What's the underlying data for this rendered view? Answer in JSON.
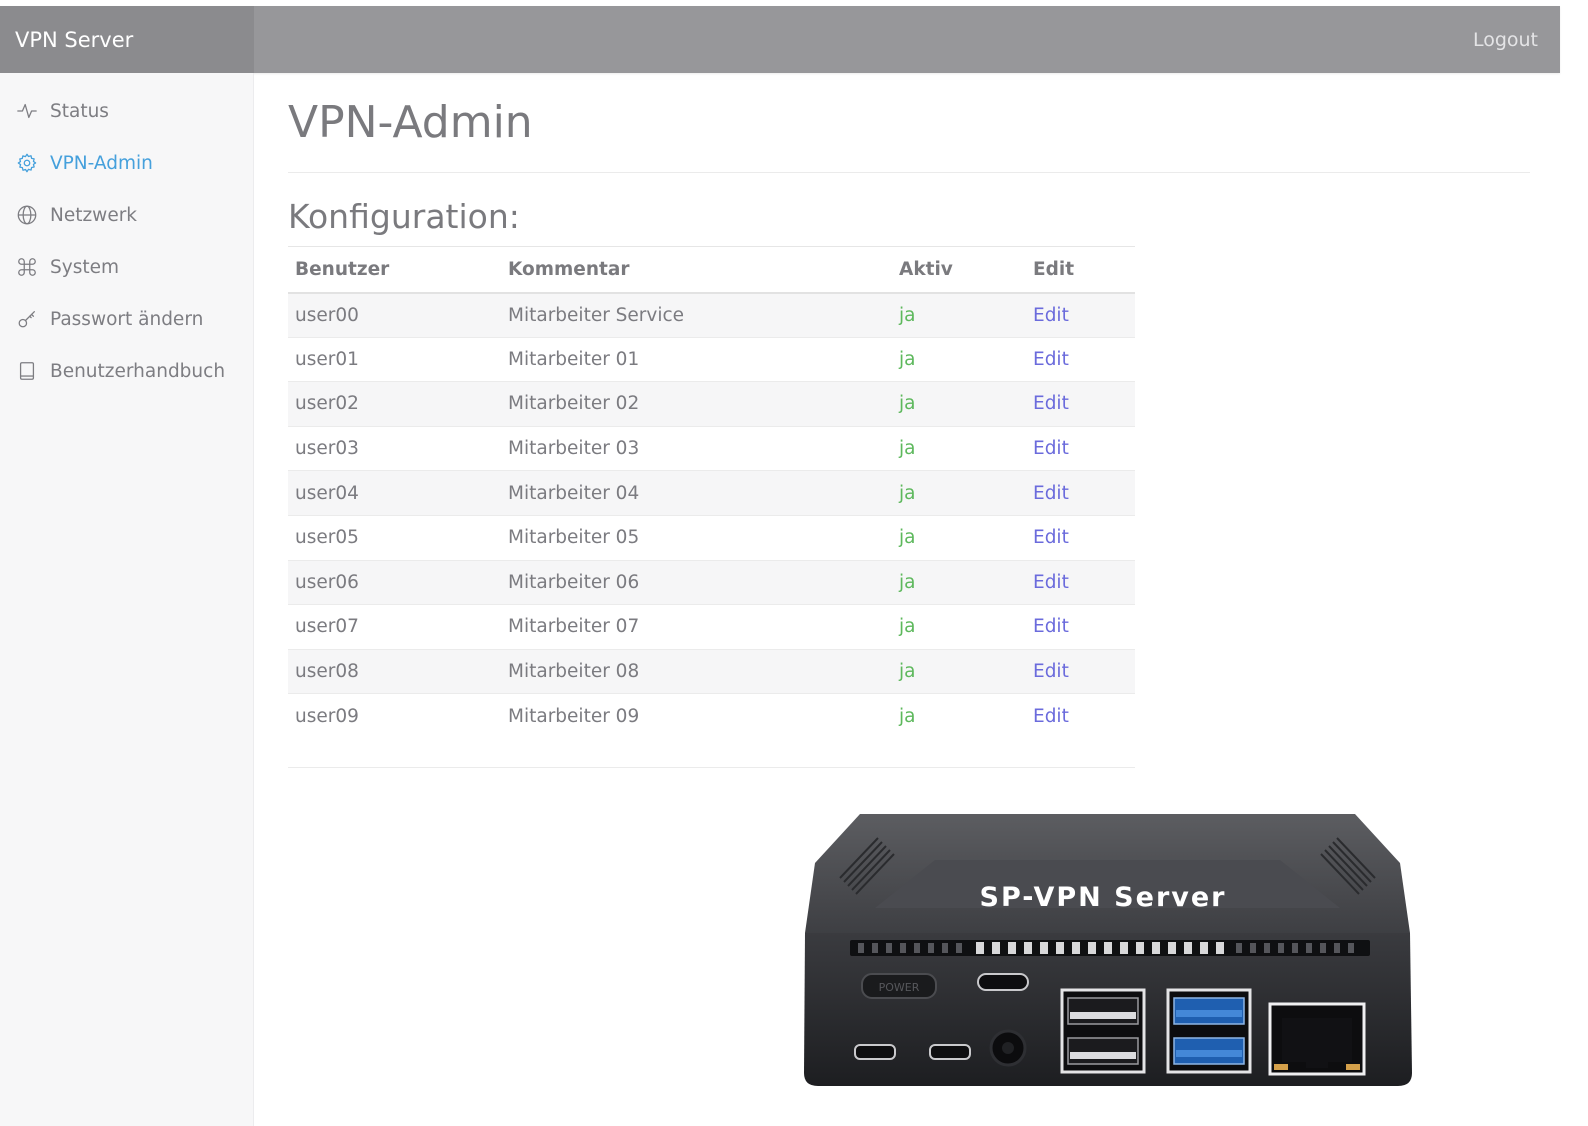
{
  "header": {
    "brand": "VPN Server",
    "logout_label": "Logout"
  },
  "sidebar": {
    "items": [
      {
        "label": "Status",
        "icon": "activity-icon",
        "active": false
      },
      {
        "label": "VPN-Admin",
        "icon": "gear-icon",
        "active": true
      },
      {
        "label": "Netzwerk",
        "icon": "globe-icon",
        "active": false
      },
      {
        "label": "System",
        "icon": "command-icon",
        "active": false
      },
      {
        "label": "Passwort ändern",
        "icon": "key-icon",
        "active": false
      },
      {
        "label": "Benutzerhandbuch",
        "icon": "book-icon",
        "active": false
      }
    ]
  },
  "main": {
    "title": "VPN-Admin",
    "section_title": "Konfiguration:",
    "table": {
      "columns": [
        "Benutzer",
        "Kommentar",
        "Aktiv",
        "Edit"
      ],
      "rows": [
        {
          "user": "user00",
          "comment": "Mitarbeiter Service",
          "active": "ja",
          "edit": "Edit"
        },
        {
          "user": "user01",
          "comment": "Mitarbeiter 01",
          "active": "ja",
          "edit": "Edit"
        },
        {
          "user": "user02",
          "comment": "Mitarbeiter 02",
          "active": "ja",
          "edit": "Edit"
        },
        {
          "user": "user03",
          "comment": "Mitarbeiter 03",
          "active": "ja",
          "edit": "Edit"
        },
        {
          "user": "user04",
          "comment": "Mitarbeiter 04",
          "active": "ja",
          "edit": "Edit"
        },
        {
          "user": "user05",
          "comment": "Mitarbeiter 05",
          "active": "ja",
          "edit": "Edit"
        },
        {
          "user": "user06",
          "comment": "Mitarbeiter 06",
          "active": "ja",
          "edit": "Edit"
        },
        {
          "user": "user07",
          "comment": "Mitarbeiter 07",
          "active": "ja",
          "edit": "Edit"
        },
        {
          "user": "user08",
          "comment": "Mitarbeiter 08",
          "active": "ja",
          "edit": "Edit"
        },
        {
          "user": "user09",
          "comment": "Mitarbeiter 09",
          "active": "ja",
          "edit": "Edit"
        }
      ]
    }
  },
  "device": {
    "label": "SP-VPN Server",
    "power_label": "POWER"
  },
  "colors": {
    "accent": "#45a0dc",
    "active_green": "#5db85c",
    "link": "#6b6bdc",
    "topbar": "#97979a"
  }
}
